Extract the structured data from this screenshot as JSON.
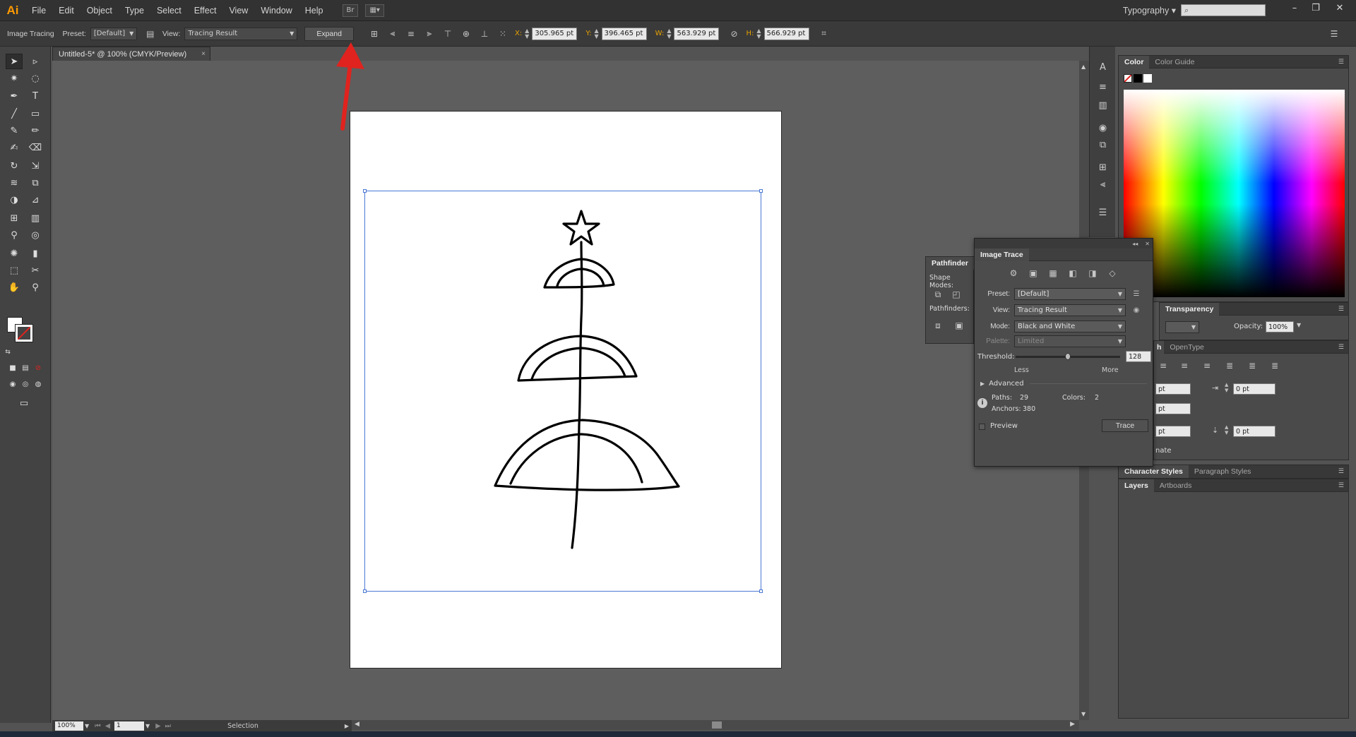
{
  "app": {
    "logo": "Ai"
  },
  "menu": [
    "File",
    "Edit",
    "Object",
    "Type",
    "Select",
    "Effect",
    "View",
    "Window",
    "Help"
  ],
  "menubar_icons": {
    "bridge": "Br",
    "arrange": "▦▾"
  },
  "workspace": "Typography",
  "window_controls": {
    "minimize": "–",
    "restore": "❐",
    "close": "✕"
  },
  "control_bar": {
    "mode_label": "Image Tracing",
    "preset_label": "Preset:",
    "preset_value": "[Default]",
    "view_label": "View:",
    "view_value": "Tracing Result",
    "expand_button": "Expand",
    "x_label": "X:",
    "x_value": "305.965 pt",
    "y_label": "Y:",
    "y_value": "396.465 pt",
    "w_label": "W:",
    "w_value": "563.929 pt",
    "h_label": "H:",
    "h_value": "566.929 pt"
  },
  "document_tab": {
    "title": "Untitled-5* @ 100% (CMYK/Preview)",
    "close": "×"
  },
  "status_bar": {
    "zoom": "100%",
    "page": "1",
    "tool": "Selection"
  },
  "color_panel": {
    "tabs": [
      "Color",
      "Color Guide"
    ]
  },
  "transparency_panel": {
    "tab": "Transparency",
    "opacity_label": "Opacity:",
    "opacity_value": "100%"
  },
  "paragraph_panel": {
    "tabs": [
      "h",
      "OpenType"
    ],
    "fields": [
      "pt",
      "0 pt",
      "pt",
      "pt",
      "0 pt"
    ],
    "truncated_label": "nate"
  },
  "styles_panel": {
    "tabs": [
      "Character Styles",
      "Paragraph Styles"
    ]
  },
  "layers_panel": {
    "tabs": [
      "Layers",
      "Artboards"
    ]
  },
  "pathfinder_panel": {
    "tab": "Pathfinder",
    "shape_modes_label": "Shape Modes:",
    "pathfinders_label": "Pathfinders:"
  },
  "image_trace": {
    "title": "Image Trace",
    "preset_label": "Preset:",
    "preset_value": "[Default]",
    "view_label": "View:",
    "view_value": "Tracing Result",
    "mode_label": "Mode:",
    "mode_value": "Black and White",
    "palette_label": "Palette:",
    "palette_value": "Limited",
    "threshold_label": "Threshold:",
    "threshold_value": "128",
    "threshold_fraction": 0.5,
    "less_label": "Less",
    "more_label": "More",
    "advanced_label": "Advanced",
    "paths_label": "Paths:",
    "paths_value": "29",
    "colors_label": "Colors:",
    "colors_value": "2",
    "anchors_label": "Anchors:",
    "anchors_value": "380",
    "preview_label": "Preview",
    "trace_button": "Trace"
  },
  "colors": {
    "accent_arrow": "#e0231e",
    "selection": "#4a78d4",
    "coord_label": "#e6a100"
  }
}
